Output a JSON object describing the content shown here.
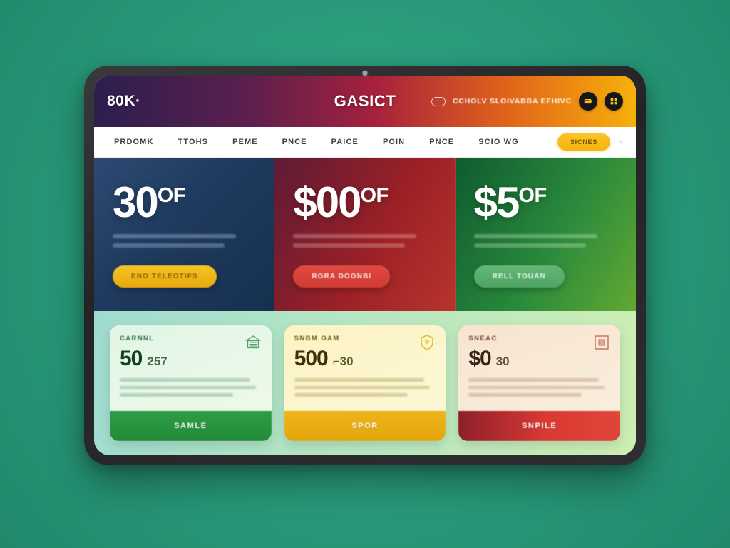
{
  "app": {
    "brand": "80K·",
    "title": "GASICT",
    "header_subtitle": "CCHOLV SLOIVABBA EFHIVC",
    "header_icons": [
      "tag-icon",
      "grid-icon"
    ],
    "pill_icon": "pill-icon"
  },
  "nav": {
    "items": [
      {
        "label": "PRDOMK"
      },
      {
        "label": "TTOHS"
      },
      {
        "label": "PEME"
      },
      {
        "label": "PNCE"
      },
      {
        "label": "PAICE"
      },
      {
        "label": "POIN"
      },
      {
        "label": "PNCE"
      },
      {
        "label": "SCIO WG"
      }
    ],
    "cta_label": "SICNES",
    "caret": "˅"
  },
  "hero": {
    "panels": [
      {
        "id": "panel-navy",
        "amount": "30",
        "suffix": "OF",
        "bg_color": "#1f3a5e",
        "cta_label": "ENO TELEOTIFS",
        "cta_style": "gold"
      },
      {
        "id": "panel-crimson",
        "amount": "$00",
        "suffix": "OF",
        "bg_color": "#9b2026",
        "cta_label": "RGRA DOGNBI",
        "cta_style": "red"
      },
      {
        "id": "panel-green",
        "amount": "$5",
        "suffix": "OF",
        "bg_color": "#2a8a3c",
        "cta_label": "RELL TOUAN",
        "cta_style": "green"
      }
    ]
  },
  "offers": {
    "cards": [
      {
        "id": "card-mint",
        "eyebrow": "CARNNL",
        "price": "50",
        "price_alt": "257",
        "badge_icon": "store-icon",
        "badge_color": "#3f8f57",
        "button_label": "SAMLE",
        "button_color": "#228a38"
      },
      {
        "id": "card-amber",
        "eyebrow": "SNBM OAM",
        "price": "500",
        "price_alt": "⌐30",
        "badge_icon": "shield-icon",
        "badge_color": "#d9ad12",
        "button_label": "SPOR",
        "button_color": "#e3a50c"
      },
      {
        "id": "card-cream",
        "eyebrow": "SNEAC",
        "price": "$0",
        "price_alt": "30",
        "badge_icon": "square-frame-icon",
        "badge_color": "#c0584a",
        "button_label": "SNPILE",
        "button_color": "#d93a33"
      }
    ]
  }
}
